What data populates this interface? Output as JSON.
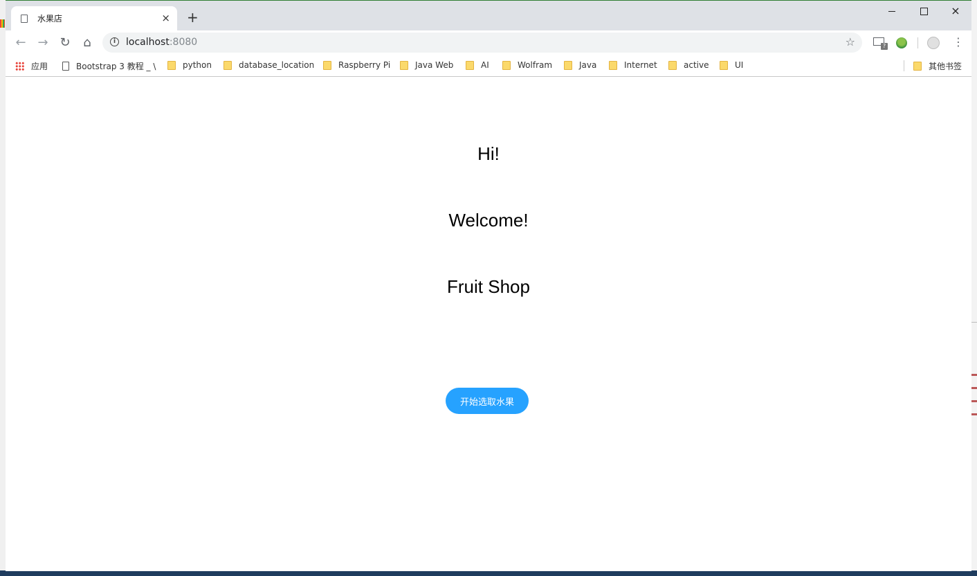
{
  "browser": {
    "tab_title": "水果店",
    "tab_close_symbol": "×",
    "new_tab_symbol": "+",
    "url_host": "localhost",
    "url_port": ":8080",
    "window_controls": {
      "minimize": "minimize-icon",
      "maximize": "maximize-icon",
      "close": "×"
    },
    "nav_icons": {
      "back": "←",
      "forward": "→",
      "reload": "↻",
      "home": "⌂",
      "star": "☆",
      "menu": "⋮"
    }
  },
  "bookmarks": {
    "apps_label": "应用",
    "items": [
      {
        "label": "Bootstrap 3 教程 _ \\",
        "icon": "page-icon"
      },
      {
        "label": "python",
        "icon": "folder-icon"
      },
      {
        "label": "database_location",
        "icon": "folder-icon"
      },
      {
        "label": "Raspberry Pi",
        "icon": "folder-icon"
      },
      {
        "label": "Java Web",
        "icon": "folder-icon"
      },
      {
        "label": "AI",
        "icon": "folder-icon"
      },
      {
        "label": "Wolfram",
        "icon": "folder-icon"
      },
      {
        "label": "Java",
        "icon": "folder-icon"
      },
      {
        "label": "Internet",
        "icon": "folder-icon"
      },
      {
        "label": "active",
        "icon": "folder-icon"
      },
      {
        "label": "UI",
        "icon": "folder-icon"
      }
    ],
    "other_label": "其他书签"
  },
  "page": {
    "greeting": "Hi!",
    "welcome": "Welcome!",
    "shop_name": "Fruit Shop",
    "start_button": "开始选取水果",
    "button_color": "#26a2ff"
  }
}
